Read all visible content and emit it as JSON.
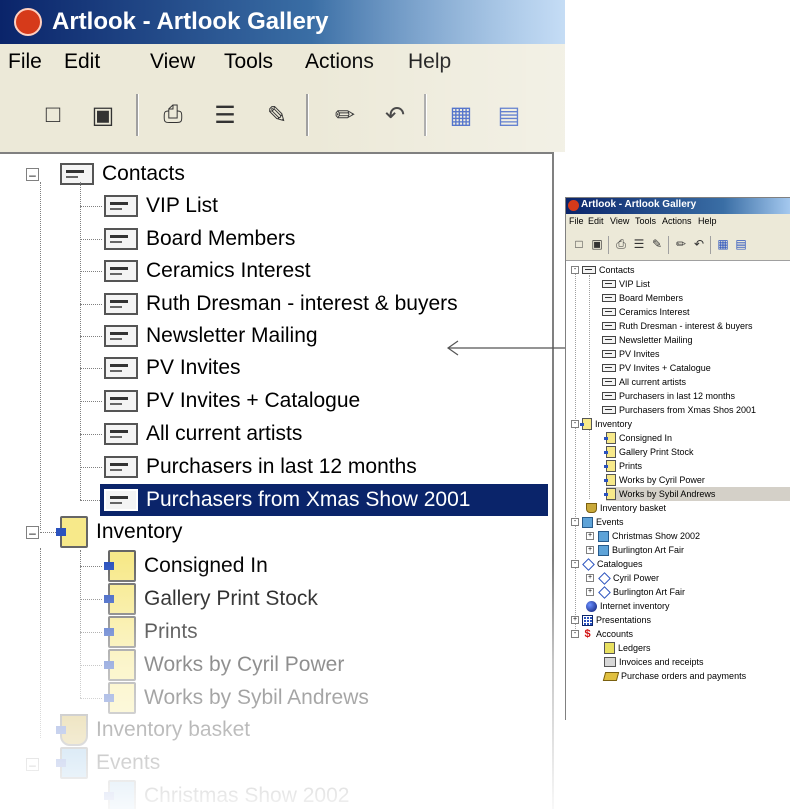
{
  "app": {
    "title": "Artlook - Artlook Gallery"
  },
  "big_menu": [
    "File",
    "Edit",
    "View",
    "Tools",
    "Actions",
    "Help"
  ],
  "small_menu": [
    "File",
    "Edit",
    "View",
    "Tools",
    "Actions",
    "Help"
  ],
  "big_tree": {
    "contacts_label": "Contacts",
    "contacts_children": [
      "VIP List",
      "Board Members",
      "Ceramics Interest",
      "Ruth Dresman - interest & buyers",
      "Newsletter Mailing",
      "PV Invites",
      "PV Invites + Catalogue",
      "All current artists",
      "Purchasers in last 12 months",
      "Purchasers from Xmas Show 2001"
    ],
    "inventory_label": "Inventory",
    "inventory_children": [
      "Consigned In",
      "Gallery Print Stock",
      "Prints",
      "Works by Cyril Power",
      "Works by Sybil Andrews"
    ],
    "basket_label": "Inventory basket",
    "events_label": "Events",
    "christmas_label": "Christmas Show 2002"
  },
  "small_tree": {
    "contacts_label": "Contacts",
    "contacts_children": [
      "VIP List",
      "Board Members",
      "Ceramics Interest",
      "Ruth Dresman - interest & buyers",
      "Newsletter Mailing",
      "PV Invites",
      "PV Invites + Catalogue",
      "All current artists",
      "Purchasers in last 12 months",
      "Purchasers from Xmas Shos 2001"
    ],
    "inventory_label": "Inventory",
    "inventory_children": [
      "Consigned In",
      "Gallery Print Stock",
      "Prints",
      "Works by Cyril Power",
      "Works by Sybil Andrews"
    ],
    "basket_label": "Inventory basket",
    "events_label": "Events",
    "events_children": [
      "Christmas Show 2002",
      "Burlington Art Fair"
    ],
    "catalogues_label": "Catalogues",
    "catalogues_children": [
      "Cyril Power",
      "Burlington Art Fair"
    ],
    "internet_label": "Internet inventory",
    "presentations_label": "Presentations",
    "accounts_label": "Accounts",
    "accounts_children": [
      "Ledgers",
      "Invoices and receipts",
      "Purchase orders and payments"
    ]
  },
  "colors": {
    "selection_dark": "#0a246a",
    "selection_light": "#d4d0c8",
    "titlebar": "#0a246a",
    "chrome": "#ece9d8"
  },
  "icons": {
    "contact_list": "contact-card-icon",
    "inventory": "inventory-clipboard-icon",
    "basket": "basket-icon",
    "events": "events-globe-icon",
    "catalogue": "catalogue-diamond-icon",
    "internet": "globe-icon",
    "presentations": "grid-icon",
    "accounts": "dollar-icon"
  }
}
